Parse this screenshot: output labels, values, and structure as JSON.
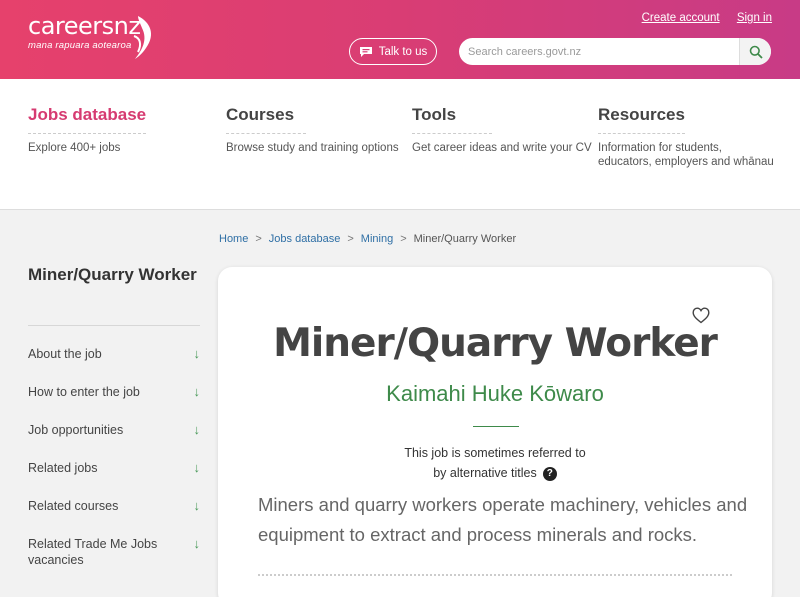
{
  "header": {
    "logo_main": "careersnz",
    "logo_tagline": "mana rapuara aotearoa",
    "create_account": "Create account",
    "sign_in": "Sign in",
    "talk_label": "Talk to us",
    "talk_icon": "chat-icon",
    "search_placeholder": "Search careers.govt.nz",
    "search_icon": "magnifier-icon"
  },
  "nav": [
    {
      "title": "Jobs database",
      "sub": "Explore 400+ jobs",
      "active": true
    },
    {
      "title": "Courses",
      "sub": "Browse study and training options"
    },
    {
      "title": "Tools",
      "sub": "Get career ideas and write your CV"
    },
    {
      "title": "Resources",
      "sub": "Information for students, educators, employers and whānau"
    }
  ],
  "breadcrumb": {
    "home": "Home",
    "jobs": "Jobs database",
    "mining": "Mining",
    "current": "Miner/Quarry Worker",
    "separator": ">"
  },
  "sidebar": {
    "title": "Miner/Quarry Worker",
    "items": [
      {
        "label": "About the job"
      },
      {
        "label": "How to enter the job"
      },
      {
        "label": "Job opportunities"
      },
      {
        "label": "Related jobs"
      },
      {
        "label": "Related courses"
      },
      {
        "label": "Related Trade Me Jobs vacancies"
      }
    ],
    "arrow": "↓"
  },
  "card": {
    "title": "Miner/Quarry Worker",
    "maori_title": "Kaimahi Huke Kōwaro",
    "alt_line1": "This job is sometimes referred to",
    "alt_line2": "by alternative titles",
    "help_symbol": "?",
    "summary": "Miners and quarry workers operate machinery, vehicles and equipment to extract and process minerals and rocks."
  },
  "colors": {
    "brand_pink": "#d63b71",
    "maori_green": "#3e8a4a",
    "link_blue": "#2f6fa5"
  }
}
